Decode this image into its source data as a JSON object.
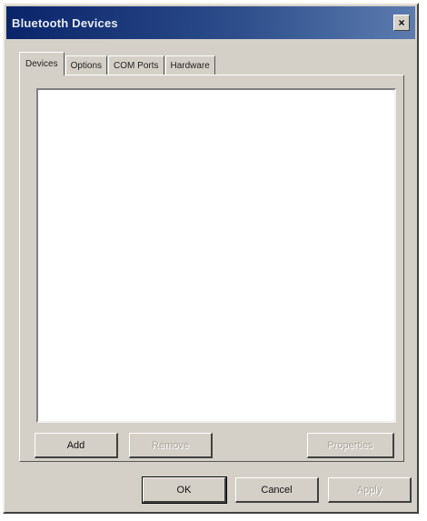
{
  "window": {
    "title": "Bluetooth Devices",
    "close_glyph": "×"
  },
  "tabs": [
    {
      "label": "Devices",
      "active": true
    },
    {
      "label": "Options",
      "active": false
    },
    {
      "label": "COM Ports",
      "active": false
    },
    {
      "label": "Hardware",
      "active": false
    }
  ],
  "devices_panel": {
    "add_label": "Add",
    "remove_label": "Remove",
    "properties_label": "Properties"
  },
  "footer": {
    "ok_label": "OK",
    "cancel_label": "Cancel",
    "apply_label": "Apply"
  },
  "icons": {
    "close": "close-icon"
  }
}
